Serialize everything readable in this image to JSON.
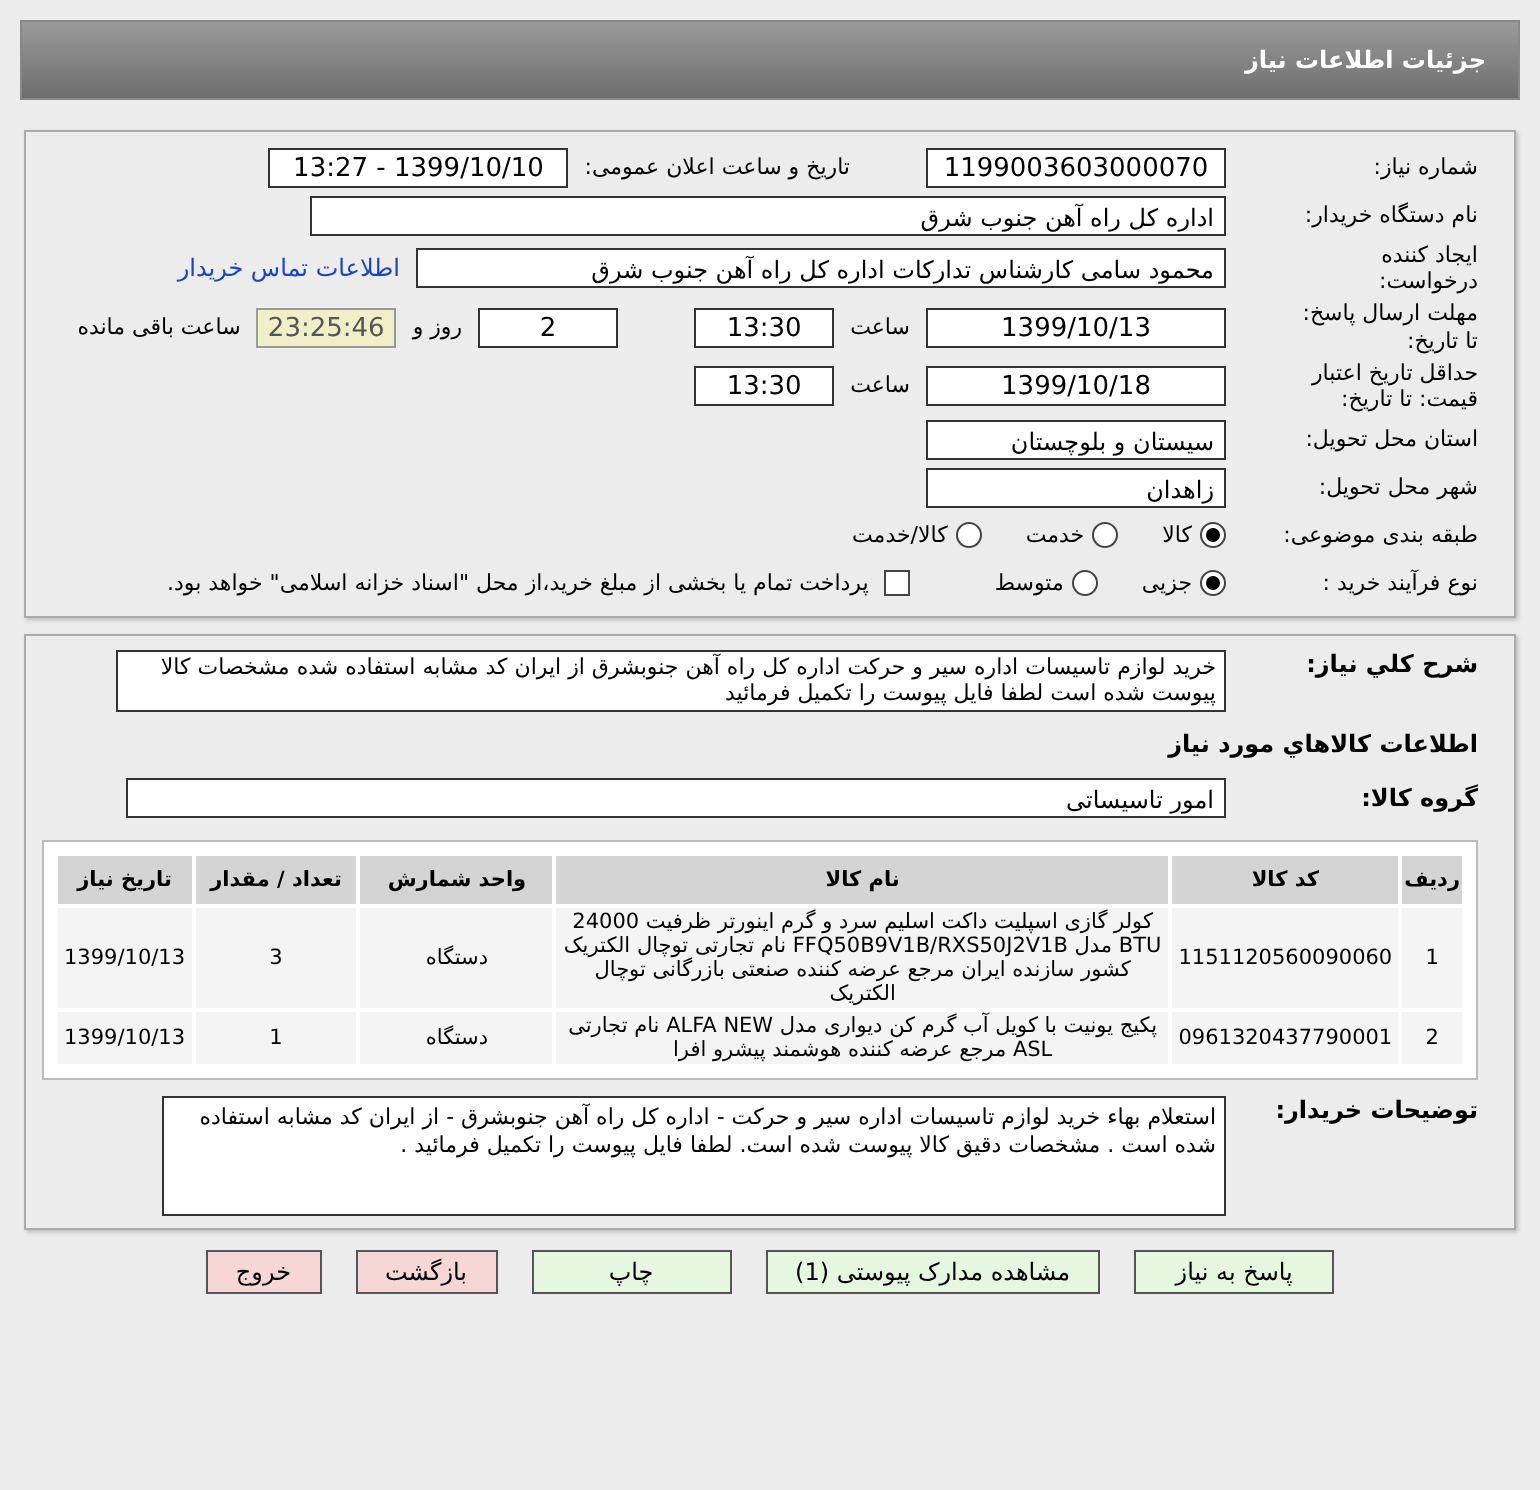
{
  "header": {
    "title": "جزئیات اطلاعات نیاز"
  },
  "need": {
    "number_label": "شماره نیاز:",
    "number": "1199003603000070",
    "announce_label": "تاریخ و ساعت اعلان عمومی:",
    "announce": "1399/10/10 - 13:27"
  },
  "buyer": {
    "label": "نام دستگاه خریدار:",
    "value": "اداره کل راه آهن جنوب شرق"
  },
  "creator": {
    "label": "ایجاد کننده\nدرخواست:",
    "value": "محمود سامی  کارشناس تدارکات  اداره کل راه آهن جنوب شرق",
    "contact_link": "اطلاعات تماس خریدار"
  },
  "deadline": {
    "label": "مهلت ارسال پاسخ:\nتا تاریخ:",
    "date": "1399/10/13",
    "time_label": "ساعت",
    "time": "13:30",
    "days": "2",
    "days_label": "روز و",
    "remaining": "23:25:46",
    "remaining_label": "ساعت باقی مانده"
  },
  "validity": {
    "label": "حداقل تاریخ اعتبار\nقیمت: تا تاریخ:",
    "date": "1399/10/18",
    "time_label": "ساعت",
    "time": "13:30"
  },
  "province": {
    "label": "استان محل تحویل:",
    "value": "سیستان و بلوچستان"
  },
  "city": {
    "label": "شهر محل تحویل:",
    "value": "زاهدان"
  },
  "category": {
    "label": "طبقه بندی موضوعی:",
    "options": [
      {
        "label": "کالا",
        "selected": true
      },
      {
        "label": "خدمت",
        "selected": false
      },
      {
        "label": "کالا/خدمت",
        "selected": false
      }
    ]
  },
  "process": {
    "label": "نوع فرآیند خرید :",
    "options": [
      {
        "label": "جزیی",
        "selected": true
      },
      {
        "label": "متوسط",
        "selected": false
      }
    ],
    "payment": {
      "checked": false,
      "text": "پرداخت تمام یا بخشی از مبلغ خرید،از محل \"اسناد خزانه اسلامی\" خواهد بود."
    }
  },
  "description": {
    "label": "شرح کلي نياز:",
    "value": "خرید لوازم تاسیسات اداره سیر و حرکت  اداره کل راه آهن جنوبشرق از ایران کد مشابه استفاده شده مشخصات کالا پیوست شده است لطفا فایل پیوست را تکمیل فرمائید"
  },
  "items": {
    "title": "اطلاعات کالاهاي مورد نياز",
    "group_label": "گروه کالا:",
    "group": "امور تاسیساتی"
  },
  "table": {
    "columns": [
      "ردیف",
      "کد کالا",
      "نام کالا",
      "واحد شمارش",
      "تعداد / مقدار",
      "تاریخ نیاز"
    ],
    "rows": [
      [
        "1",
        "1151120560090060",
        "کولر گازی اسپلیت داکت اسلیم سرد و گرم اینورتر ظرفیت 24000 BTU مدل FFQ50B9V1B/RXS50J2V1B نام تجارتی توچال الکتریک کشور سازنده ایران مرجع عرضه کننده صنعتی بازرگانی توچال الکتریک",
        "دستگاه",
        "3",
        "1399/10/13"
      ],
      [
        "2",
        "0961320437790001",
        "پکیج یونیت با کویل آب گرم کن دیواری مدل ALFA NEW نام تجارتی ASL مرجع عرضه کننده هوشمند پیشرو افرا",
        "دستگاه",
        "1",
        "1399/10/13"
      ]
    ]
  },
  "notes": {
    "label": "توضیحات خریدار:",
    "value": "استعلام بهاء خرید لوازم تاسیسات اداره سیر و حرکت - اداره کل راه آهن جنوبشرق - از ایران کد مشابه استفاده شده است . مشخصات دقیق کالا پیوست شده است. لطفا فایل پیوست را تکمیل فرمائید ."
  },
  "buttons": [
    {
      "label": "پاسخ به نیاز",
      "kind": "action"
    },
    {
      "label": "مشاهده مدارک پیوستی (1)",
      "kind": "action"
    },
    {
      "label": "چاپ",
      "kind": "action"
    },
    {
      "label": "بازگشت",
      "kind": "exit"
    },
    {
      "label": "خروج",
      "kind": "exit"
    }
  ]
}
